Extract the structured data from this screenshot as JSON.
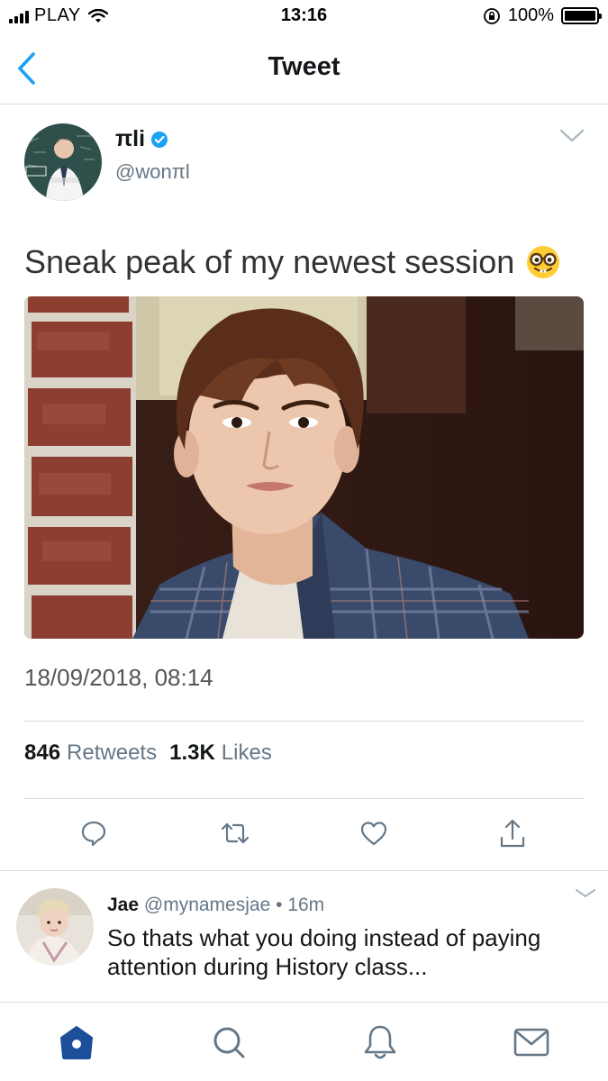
{
  "status_bar": {
    "carrier": "PLAY",
    "time": "13:16",
    "battery": "100%",
    "battery_level": 1.0
  },
  "nav": {
    "title": "Tweet",
    "back_icon": "chevron-left-icon"
  },
  "tweet": {
    "author_name": "πli",
    "author_handle": "@wonπl",
    "verified": true,
    "text": "Sneak peak of my newest session",
    "emoji": "nerd-face-emoji",
    "timestamp": "18/09/2018, 08:14",
    "retweets_count": "846",
    "retweets_label": "Retweets",
    "likes_count": "1.3K",
    "likes_label": "Likes"
  },
  "actions": [
    "reply-icon",
    "retweet-icon",
    "like-icon",
    "share-icon"
  ],
  "reply": {
    "name": "Jae",
    "handle": "@mynamesjae",
    "separator": " • ",
    "age": "16m",
    "text": "So thats what you doing instead of paying attention during History class..."
  },
  "tab_bar": [
    "home-icon",
    "search-icon",
    "notifications-icon",
    "messages-icon"
  ],
  "colors": {
    "accent": "#1da1f2",
    "tab_active": "#1d4e9a",
    "secondary_text": "#657786",
    "divider": "#d6d9db"
  }
}
